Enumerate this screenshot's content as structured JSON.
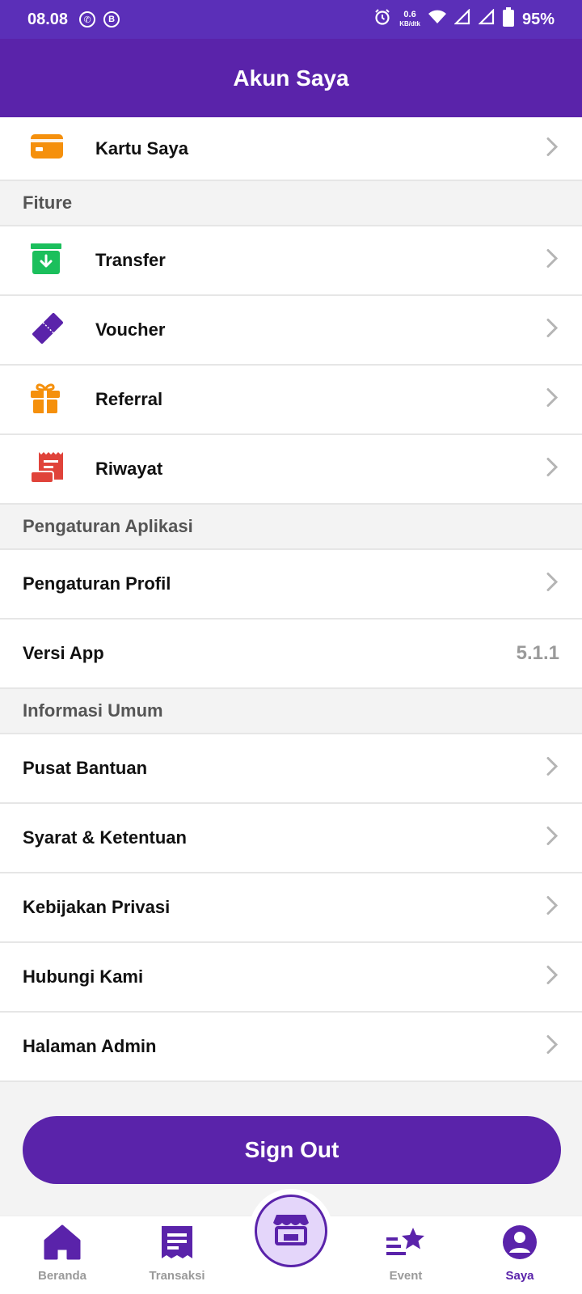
{
  "status_bar": {
    "time": "08.08",
    "net_speed_value": "0.6",
    "net_speed_unit": "KB/dtk",
    "battery": "95%"
  },
  "header": {
    "title": "Akun Saya"
  },
  "top_item": {
    "label": "Kartu Saya",
    "icon": "card-icon"
  },
  "sections": {
    "fiture": {
      "title": "Fiture",
      "items": [
        {
          "label": "Transfer",
          "icon": "transfer-icon"
        },
        {
          "label": "Voucher",
          "icon": "voucher-icon"
        },
        {
          "label": "Referral",
          "icon": "gift-icon"
        },
        {
          "label": "Riwayat",
          "icon": "receipt-icon"
        }
      ]
    },
    "app_settings": {
      "title": "Pengaturan Aplikasi",
      "profile_label": "Pengaturan Profil",
      "version_label": "Versi App",
      "version_value": "5.1.1"
    },
    "general_info": {
      "title": "Informasi Umum",
      "items": [
        {
          "label": "Pusat Bantuan"
        },
        {
          "label": "Syarat & Ketentuan"
        },
        {
          "label": "Kebijakan Privasi"
        },
        {
          "label": "Hubungi Kami"
        },
        {
          "label": "Halaman Admin"
        }
      ]
    }
  },
  "actions": {
    "sign_out": "Sign Out"
  },
  "bottom_nav": {
    "items": [
      {
        "label": "Beranda",
        "icon": "home-icon"
      },
      {
        "label": "Transaksi",
        "icon": "transaction-icon"
      },
      {
        "label": "",
        "icon": "store-icon"
      },
      {
        "label": "Event",
        "icon": "event-star-icon"
      },
      {
        "label": "Saya",
        "icon": "profile-icon",
        "active": true
      }
    ]
  },
  "colors": {
    "primary": "#5a23aa",
    "status_bar": "#5b2fb8",
    "card_icon": "#f5900c",
    "transfer_icon": "#1bbf5c",
    "voucher_icon": "#5a23aa",
    "referral_icon": "#f5900c",
    "history_icon": "#e0433a"
  }
}
